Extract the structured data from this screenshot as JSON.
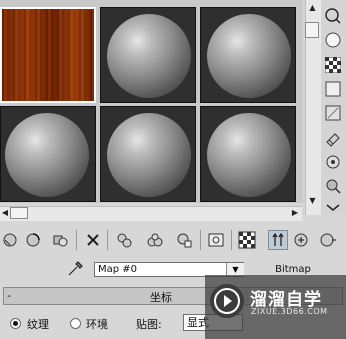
{
  "slots": [
    {
      "type": "wood",
      "selected": true
    },
    {
      "type": "sphere",
      "selected": false
    },
    {
      "type": "sphere",
      "selected": false
    },
    {
      "type": "sphere",
      "selected": false
    },
    {
      "type": "sphere",
      "selected": false
    },
    {
      "type": "sphere",
      "selected": false
    }
  ],
  "right_toolbar": {
    "icons": [
      "sample-type-sphere-icon",
      "backlight-icon",
      "background-checker-icon",
      "sample-uv-tiling-icon",
      "video-color-check-icon",
      "make-preview-icon",
      "options-icon",
      "select-by-material-icon",
      "material-navigator-icon"
    ]
  },
  "bottom_toolbar": {
    "icons": [
      "get-material-icon",
      "put-to-scene-icon",
      "assign-material-icon",
      "reset-map-icon",
      "copy-material-icon",
      "make-unique-icon",
      "put-to-library-icon",
      "material-id-channel-icon",
      "show-map-in-viewport-icon",
      "show-end-result-icon",
      "go-to-parent-icon",
      "go-forward-sibling-icon"
    ]
  },
  "map_row": {
    "eyedropper_icon": "eyedropper-icon",
    "map_name": "Map #0",
    "map_type": "Bitmap"
  },
  "rollout": {
    "collapse_symbol": "-",
    "title": "坐标"
  },
  "coords": {
    "texture_label": "纹理",
    "environ_label": "环境",
    "mapping_label": "贴图:",
    "mapping_value": "显式"
  },
  "watermark": {
    "name": "溜溜自学",
    "url": "ZIXUE.3D66.COM"
  }
}
